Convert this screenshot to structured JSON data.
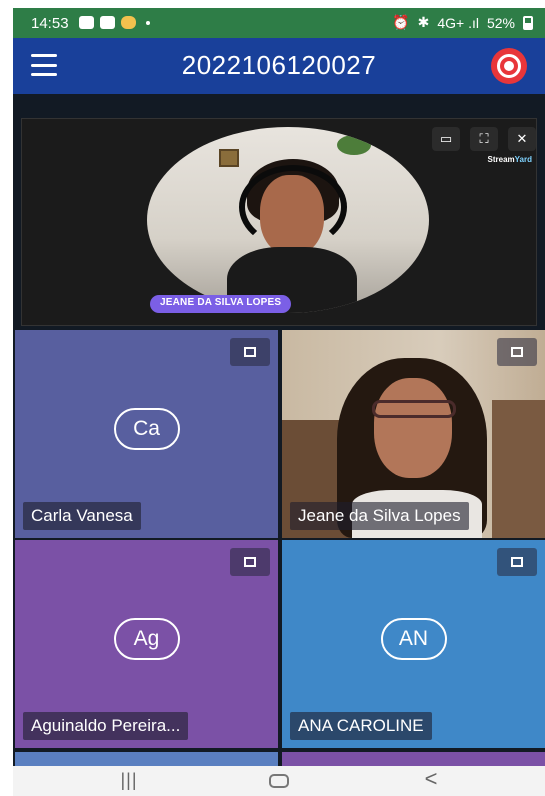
{
  "status_bar": {
    "time": "14:53",
    "signal_text": "4G+ .ıl",
    "battery": "52%"
  },
  "app_bar": {
    "title": "2022106120027"
  },
  "stage": {
    "speaker_label": "JEANE DA SILVA LOPES",
    "logo_text_stream": "Stream",
    "logo_text_yard": "Yard"
  },
  "participants": [
    {
      "initials": "Ca",
      "name": "Carla Vanesa",
      "color": "#585f9f"
    },
    {
      "initials": "",
      "name": "Jeane da Silva Lopes",
      "color": "#8a6a4e"
    },
    {
      "initials": "Ag",
      "name": "Aguinaldo Pereira...",
      "color": "#7b51a6"
    },
    {
      "initials": "AN",
      "name": "ANA CAROLINE",
      "color": "#3f88c8"
    }
  ],
  "nav_bar": {
    "recent": "|||",
    "back": "<"
  }
}
